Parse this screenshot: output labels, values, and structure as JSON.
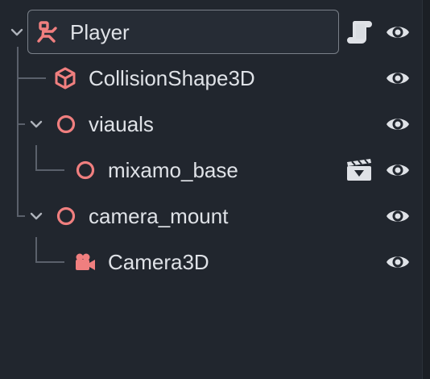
{
  "scene_tree": {
    "nodes": [
      {
        "label": "Player",
        "icon": "character-body-icon",
        "expanded": true,
        "selected": true,
        "extra_icon": "script-icon",
        "visible": true
      },
      {
        "label": "CollisionShape3D",
        "icon": "collision-shape-icon",
        "visible": true
      },
      {
        "label": "viauals",
        "icon": "node3d-icon",
        "expanded": true,
        "visible": true
      },
      {
        "label": "mixamo_base",
        "icon": "node3d-icon",
        "extra_icon": "animation-scene-icon",
        "visible": true
      },
      {
        "label": "camera_mount",
        "icon": "node3d-icon",
        "expanded": true,
        "visible": true
      },
      {
        "label": "Camera3D",
        "icon": "camera-icon",
        "visible": true
      }
    ]
  },
  "colors": {
    "node_icon": "#f07f7f",
    "text": "#dfe2e7",
    "tree_line": "#5a606b",
    "panel_bg": "#21262e"
  }
}
